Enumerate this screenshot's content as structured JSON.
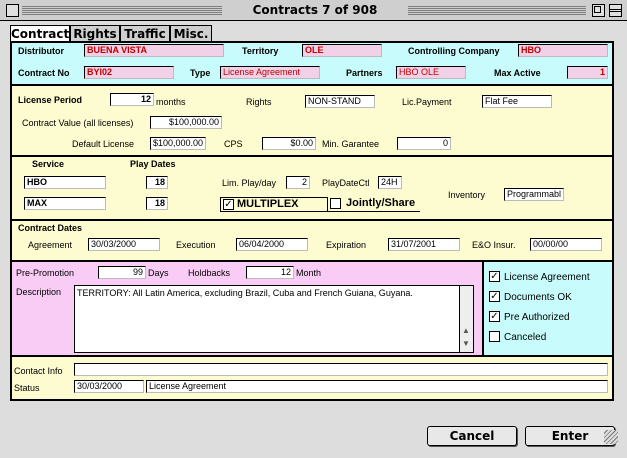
{
  "window": {
    "title": "Contracts 7 of 908"
  },
  "tabs": [
    {
      "label": "Contract"
    },
    {
      "label": "Rights"
    },
    {
      "label": "Traffic"
    },
    {
      "label": "Misc."
    }
  ],
  "header": {
    "distributor_label": "Distributor",
    "distributor": "BUENA VISTA",
    "territory_label": "Territory",
    "territory": "OLE",
    "controlling_label": "Controlling Company",
    "controlling": "HBO",
    "contract_no_label": "Contract No",
    "contract_no": "BYI02",
    "type_label": "Type",
    "type": "License Agreement",
    "partners_label": "Partners",
    "partners": "HBO OLE",
    "max_active_label": "Max Active",
    "max_active": "1"
  },
  "license": {
    "period_label": "License Period",
    "period": "12",
    "months_label": "months",
    "rights_label": "Rights",
    "rights": "NON-STAND",
    "lic_payment_label": "Lic.Payment",
    "lic_payment": "Flat Fee",
    "contract_value_label": "Contract Value (all licenses)",
    "contract_value": "$100,000.00",
    "default_license_label": "Default License",
    "default_license": "$100,000.00",
    "cps_label": "CPS",
    "cps": "$0.00",
    "min_garantee_label": "Min. Garantee",
    "min_garantee": "0"
  },
  "service": {
    "service_label": "Service",
    "play_dates_label": "Play Dates",
    "rows": [
      {
        "name": "HBO",
        "dates": "18"
      },
      {
        "name": "MAX",
        "dates": "18"
      }
    ],
    "lim_play_label": "Lim. Play/day",
    "lim_play": "2",
    "playdate_ctl_label": "PlayDateCtl",
    "playdate_ctl": "24H",
    "inventory_label": "Inventory",
    "inventory": "Programmabl",
    "multiplex_label": "MULTIPLEX",
    "jointly_label": "Jointly/Share"
  },
  "dates": {
    "section_label": "Contract Dates",
    "agreement_label": "Agreement",
    "agreement": "30/03/2000",
    "execution_label": "Execution",
    "execution": "06/04/2000",
    "expiration_label": "Expiration",
    "expiration": "31/07/2001",
    "eo_label": "E&O Insur.",
    "eo": "00/00/00"
  },
  "promo": {
    "pre_promotion_label": "Pre-Promotion",
    "pre_promotion": "99",
    "days_label": "Days",
    "holdbacks_label": "Holdbacks",
    "holdbacks": "12",
    "month_label": "Month",
    "description_label": "Description",
    "description": "TERRITORY: All Latin America, excluding Brazil, Cuba and French Guiana, Guyana."
  },
  "checks": [
    {
      "label": "License Agreement",
      "checked": true
    },
    {
      "label": "Documents OK",
      "checked": true
    },
    {
      "label": "Pre Authorized",
      "checked": true
    },
    {
      "label": "Canceled",
      "checked": false
    }
  ],
  "footer": {
    "contact_label": "Contact Info",
    "contact": "",
    "status_label": "Status",
    "status_date": "30/03/2000",
    "status": "License Agreement"
  },
  "buttons": {
    "cancel": "Cancel",
    "enter": "Enter"
  },
  "colors": {
    "header_bg": "#c8fcfc",
    "form_bg": "#fdfbd0",
    "promo_bg": "#f8ccf4",
    "check_bg": "#c8fcfc",
    "value_red": "#c00000"
  }
}
